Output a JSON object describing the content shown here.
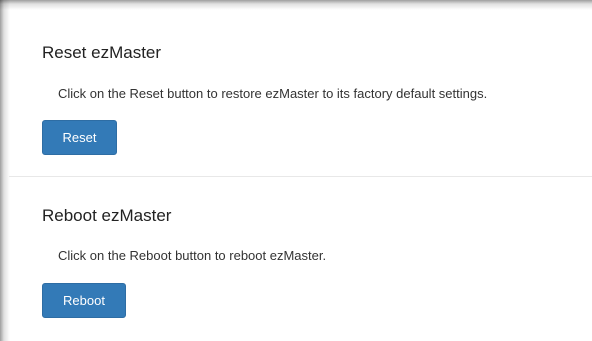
{
  "reset_section": {
    "title": "Reset ezMaster",
    "description": "Click on the Reset button to restore ezMaster to its factory default settings.",
    "button_label": "Reset"
  },
  "reboot_section": {
    "title": "Reboot ezMaster",
    "description": "Click on the Reboot button to reboot ezMaster.",
    "button_label": "Reboot"
  },
  "colors": {
    "button_bg": "#337ab7",
    "button_border": "#2e6da4",
    "button_text": "#ffffff",
    "divider": "#e8e8e8"
  }
}
